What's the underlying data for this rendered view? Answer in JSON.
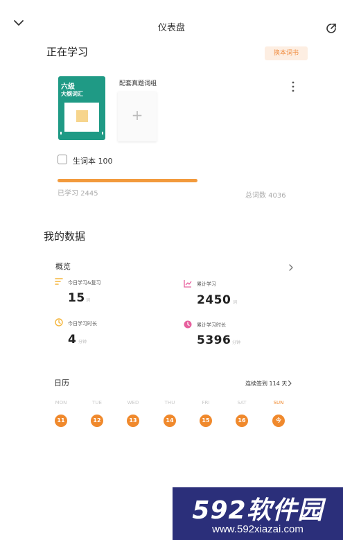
{
  "header": {
    "title": "仪表盘",
    "collapse_icon": "chevron-down-icon",
    "share_icon": "external-link-icon"
  },
  "studying": {
    "title": "正在学习",
    "change_button": "换本词书",
    "book": {
      "line1": "六级",
      "line2": "大纲词汇",
      "cover_color": "#1f9a85"
    },
    "addon": {
      "label": "配套真题词组",
      "plus": "+"
    },
    "vocab_book": "生词本 100",
    "progress": 0.606,
    "learned": "已学习 2445",
    "total": "总词数 4036",
    "accent": "#f29a3c"
  },
  "my_data": {
    "title": "我的数据",
    "overview": {
      "title": "概览",
      "stats": [
        {
          "label": "今日学习&复习",
          "value": "15",
          "unit": "词",
          "icon": "list-icon",
          "icon_color": "#f5b53b"
        },
        {
          "label": "累计学习",
          "value": "2450",
          "unit": "词",
          "icon": "trend-chart-icon",
          "icon_color": "#e7609e"
        },
        {
          "label": "今日学习时长",
          "value": "4",
          "unit": "分钟",
          "icon": "clock-icon",
          "icon_color": "#f5b53b"
        },
        {
          "label": "累计学习时长",
          "value": "5396",
          "unit": "分钟",
          "icon": "clock-icon",
          "icon_color": "#e7609e"
        }
      ]
    },
    "calendar": {
      "title": "日历",
      "streak": "连续签到 114 天",
      "days": [
        {
          "name": "MON",
          "date": "11"
        },
        {
          "name": "TUE",
          "date": "12"
        },
        {
          "name": "WED",
          "date": "13"
        },
        {
          "name": "THU",
          "date": "14"
        },
        {
          "name": "FRI",
          "date": "15"
        },
        {
          "name": "SAT",
          "date": "16"
        },
        {
          "name": "SUN",
          "date": "今"
        }
      ],
      "today_color": "#f0892c"
    }
  },
  "watermark": {
    "main": "592软件园",
    "url": "www.592xiazai.com"
  }
}
